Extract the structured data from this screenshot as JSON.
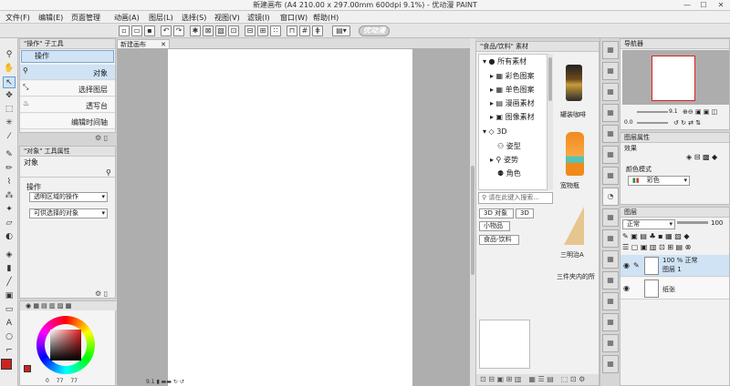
{
  "window": {
    "title": "新建画布 (A4 210.00 x 297.00mm 600dpi 9.1%)  - 优动漫 PAINT",
    "min": "—",
    "max": "☐",
    "close": "✕"
  },
  "menu": [
    "文件(F)",
    "编辑(E)",
    "页面管理",
    "动画(A)",
    "图层(L)",
    "选择(S)",
    "视图(V)",
    "滤镜(I)",
    "窗口(W)",
    "帮助(H)"
  ],
  "command_bar": {
    "logo": "优动漫"
  },
  "sub_tool": {
    "tab_label": "\"操作\" 子工具",
    "selected_group": "操作",
    "items": [
      "对象",
      "选择图层",
      "透写台",
      "编辑时间轴"
    ]
  },
  "tool_property": {
    "tab_label": "\"对象\" 工具属性",
    "title": "对象",
    "section": "操作",
    "select_1": "透明区域的操作",
    "select_2": "可供选择的对象"
  },
  "color": {
    "primary": "#cc2222",
    "secondary": "#ffffff",
    "numbers": [
      "0",
      "77",
      "77"
    ]
  },
  "canvas": {
    "tab_label": "新建画布",
    "bottom_value": "9.1"
  },
  "material": {
    "tab_label": "\"食品/饮料\" 素材",
    "tree": [
      "所有素材",
      "彩色图案",
      "单色图案",
      "漫画素材",
      "图像素材",
      "3D",
      "姿型",
      "姿势",
      "角色"
    ],
    "search_placeholder": "请在此键入搜索...",
    "tags": [
      "3D 对象",
      "3D",
      "小物品",
      "食品-饮料"
    ],
    "items": [
      "罐装咖啡",
      "宽物瓶",
      "三明治A",
      "三件夹内的所"
    ]
  },
  "navigator": {
    "tab_label": "导航器",
    "value_1": "9.1",
    "value_2": "0.0"
  },
  "layer_property": {
    "tab_label": "图层属性",
    "section": "效果",
    "mode_label": "颜色模式",
    "mode_value": "彩色"
  },
  "layer": {
    "tab_label": "图层",
    "blend": "正常",
    "opacity": "100",
    "rows": [
      {
        "line1": "100 % 正常",
        "line2": "图层 1"
      },
      {
        "line1": "",
        "line2": "纸张"
      }
    ]
  }
}
